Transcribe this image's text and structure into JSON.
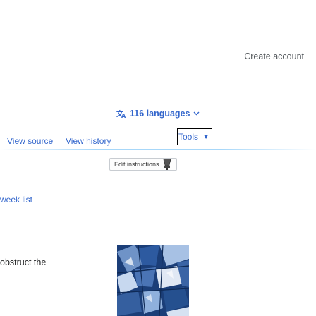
{
  "header": {
    "create_account": "Create account"
  },
  "languages": {
    "label": "116 languages",
    "icon": "translate-icon",
    "chevron": "chevron-down-icon"
  },
  "tabs": {
    "view_source": "View source",
    "view_history": "View history",
    "tools": "Tools"
  },
  "edit_bubble": {
    "text": "Edit instructions"
  },
  "content": {
    "week_list": "week list",
    "obstruct_text": "obstruct the"
  },
  "colors": {
    "link": "#3366cc",
    "text": "#202122",
    "muted": "#54595d",
    "rule": "#a7d7f9"
  }
}
